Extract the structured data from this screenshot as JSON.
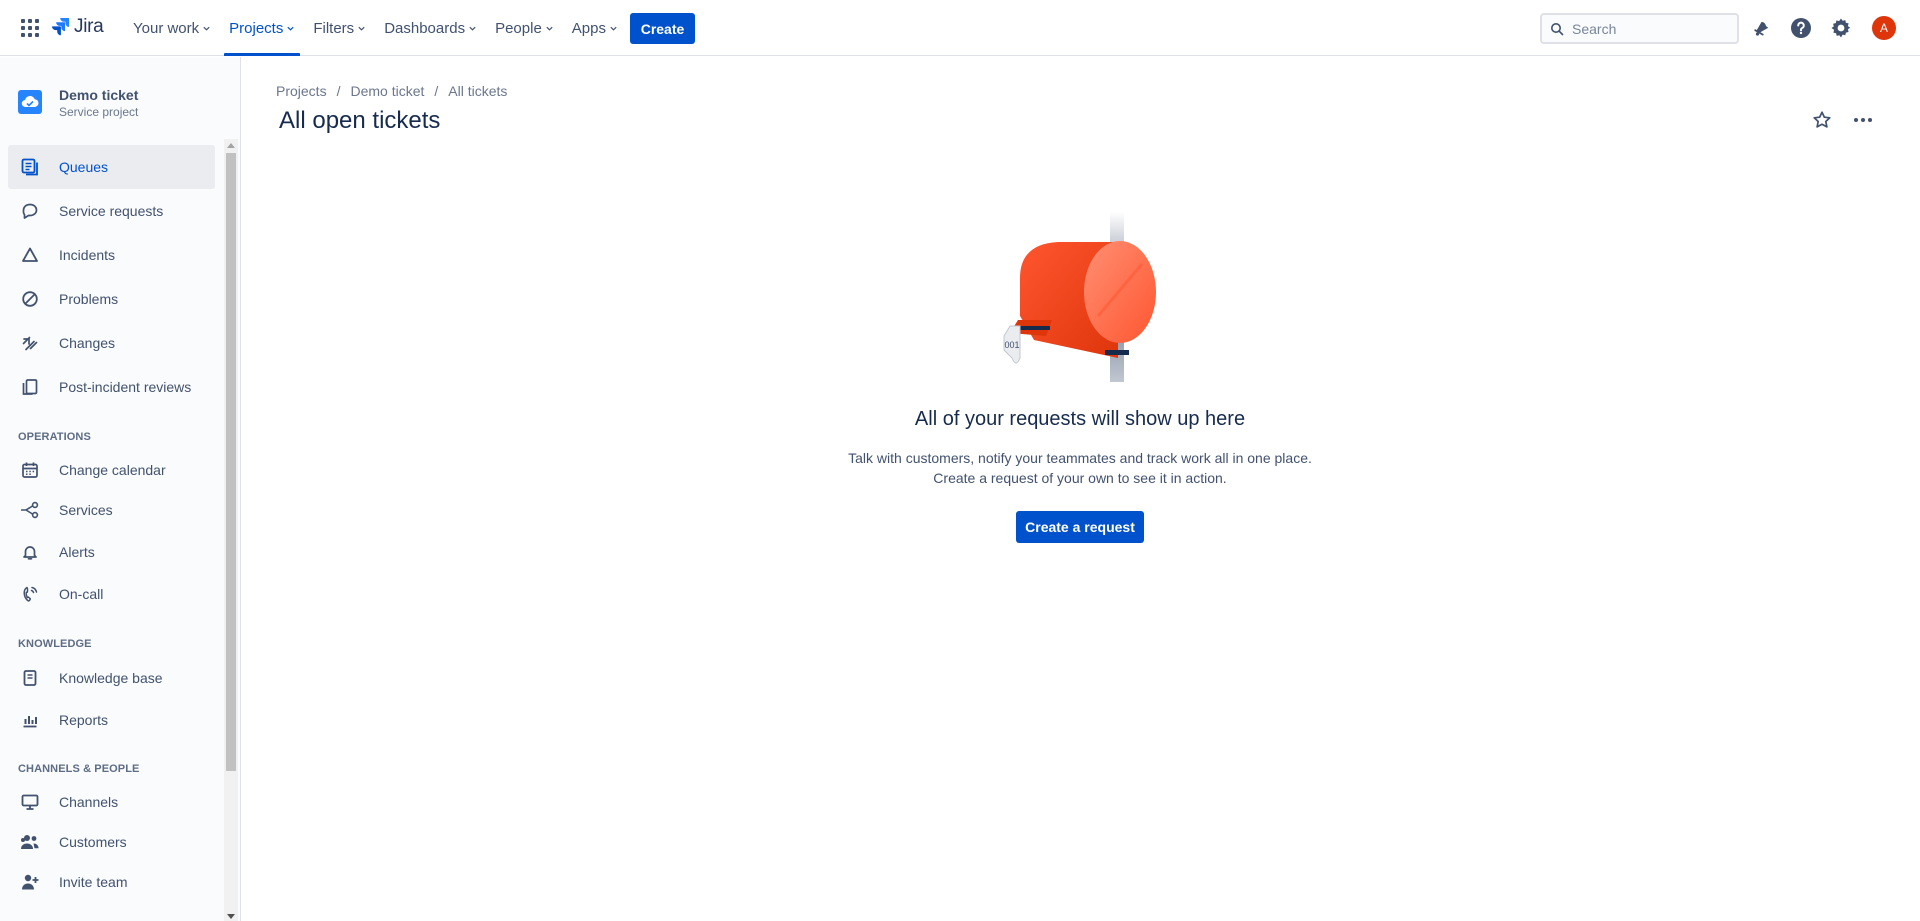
{
  "topnav": {
    "logo": "Jira",
    "items": [
      {
        "label": "Your work",
        "active": false
      },
      {
        "label": "Projects",
        "active": true
      },
      {
        "label": "Filters",
        "active": false
      },
      {
        "label": "Dashboards",
        "active": false
      },
      {
        "label": "People",
        "active": false
      },
      {
        "label": "Apps",
        "active": false
      }
    ],
    "create_label": "Create",
    "search_placeholder": "Search",
    "avatar_initial": "A",
    "icons": [
      "notifications-icon",
      "help-icon",
      "settings-icon"
    ]
  },
  "sidebar": {
    "project_name": "Demo ticket",
    "project_type": "Service project",
    "items": [
      {
        "label": "Queues",
        "icon": "queues-icon",
        "active": true
      },
      {
        "label": "Service requests",
        "icon": "speech-bubble-icon"
      },
      {
        "label": "Incidents",
        "icon": "triangle-icon"
      },
      {
        "label": "Problems",
        "icon": "prohibited-icon"
      },
      {
        "label": "Changes",
        "icon": "changes-icon"
      },
      {
        "label": "Post-incident reviews",
        "icon": "documents-icon"
      }
    ],
    "operations_heading": "OPERATIONS",
    "operations": [
      {
        "label": "Change calendar",
        "icon": "calendar-icon"
      },
      {
        "label": "Services",
        "icon": "services-icon"
      },
      {
        "label": "Alerts",
        "icon": "bell-icon"
      },
      {
        "label": "On-call",
        "icon": "phone-icon"
      }
    ],
    "knowledge_heading": "KNOWLEDGE",
    "knowledge": [
      {
        "label": "Knowledge base",
        "icon": "book-icon"
      },
      {
        "label": "Reports",
        "icon": "bar-chart-icon"
      }
    ],
    "channels_heading": "CHANNELS & PEOPLE",
    "channels": [
      {
        "label": "Channels",
        "icon": "monitor-icon"
      },
      {
        "label": "Customers",
        "icon": "people-icon"
      },
      {
        "label": "Invite team",
        "icon": "add-person-icon"
      }
    ]
  },
  "main": {
    "breadcrumb": [
      "Projects",
      "Demo ticket",
      "All tickets"
    ],
    "title": "All open tickets",
    "mailbox_label": "001",
    "empty_title": "All of your requests will show up here",
    "empty_desc_line1": "Talk with customers, notify your teammates and track work all in one place.",
    "empty_desc_line2": "Create a request of your own to see it in action.",
    "cta_label": "Create a request"
  },
  "colors": {
    "brand": "#0052cc",
    "text": "#172b4d",
    "subtle": "#42526e",
    "mailbox": "#ff5630",
    "avatar": "#de350b"
  }
}
